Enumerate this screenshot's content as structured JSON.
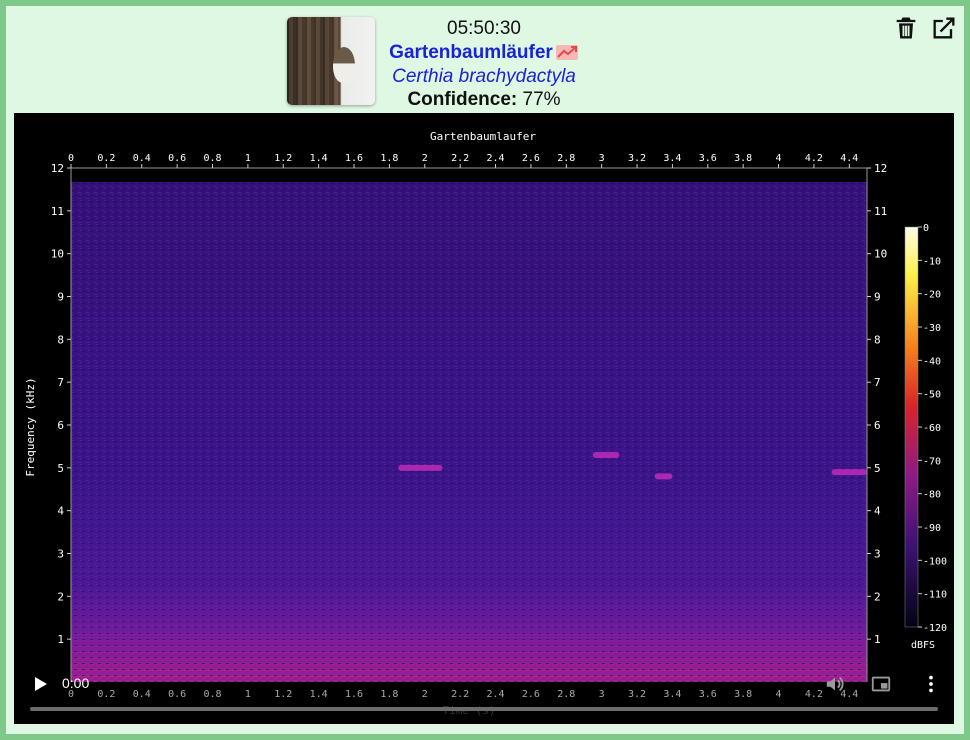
{
  "detection": {
    "time": "05:50:30",
    "common_name": "Gartenbaumläufer",
    "scientific_name": "Certhia brachydactyla",
    "confidence_label": "Confidence:",
    "confidence_value": "77%"
  },
  "icons": {
    "trend": "trend-up-icon",
    "delete": "trash-icon",
    "open": "external-link-icon",
    "play": "play-icon",
    "volume": "volume-icon",
    "pip": "picture-in-picture-icon",
    "more": "more-vert-icon"
  },
  "player": {
    "current_time": "0:00",
    "progress": 0
  },
  "chart_data": {
    "type": "heatmap",
    "title": "Gartenbaumlaufer",
    "ylabel": "Frequency (kHz)",
    "xlabel": "Time (s)",
    "x_ticks": [
      "0",
      "0.2",
      "0.4",
      "0.6",
      "0.8",
      "1",
      "1.2",
      "1.4",
      "1.6",
      "1.8",
      "2",
      "2.2",
      "2.4",
      "2.6",
      "2.8",
      "3",
      "3.2",
      "3.4",
      "3.6",
      "3.8",
      "4",
      "4.2",
      "4.4"
    ],
    "y_ticks": [
      "1",
      "2",
      "3",
      "4",
      "5",
      "6",
      "7",
      "8",
      "9",
      "10",
      "11",
      "12"
    ],
    "xlim": [
      0,
      4.5
    ],
    "ylim": [
      0,
      12
    ],
    "colorbar": {
      "label": "dBFS",
      "ticks": [
        "0",
        "-10",
        "-20",
        "-30",
        "-40",
        "-50",
        "-60",
        "-70",
        "-80",
        "-90",
        "-100",
        "-110",
        "-120"
      ],
      "range": [
        -120,
        0
      ]
    },
    "highlights": [
      {
        "t_start": 1.85,
        "t_end": 2.1,
        "freq_khz": 5.0
      },
      {
        "t_start": 2.95,
        "t_end": 3.1,
        "freq_khz": 5.3
      },
      {
        "t_start": 3.3,
        "t_end": 3.4,
        "freq_khz": 4.8
      },
      {
        "t_start": 4.3,
        "t_end": 4.5,
        "freq_khz": 4.9
      }
    ],
    "colors": {
      "background": "#3a1486",
      "low_band": "#8c1a9a",
      "highlight": "#c02ab8"
    }
  }
}
